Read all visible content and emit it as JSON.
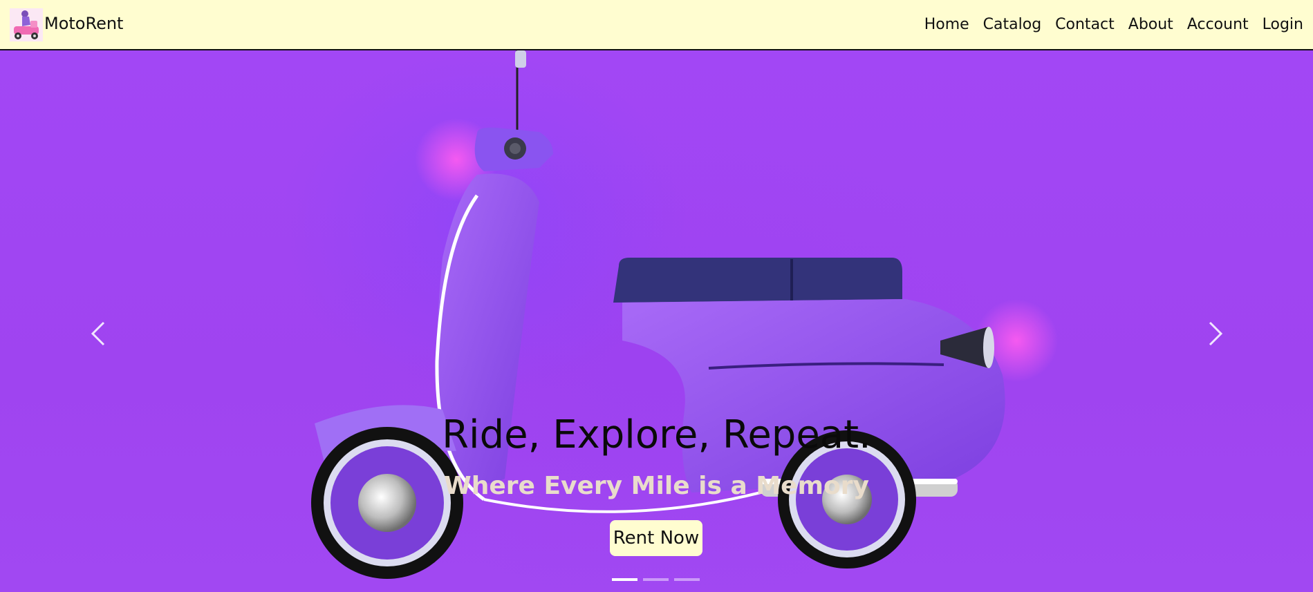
{
  "navbar": {
    "brand": "MotoRent",
    "links": [
      "Home",
      "Catalog",
      "Contact",
      "About",
      "Account",
      "Login"
    ]
  },
  "hero": {
    "title": "Ride, Explore, Repeat.",
    "subtitle": "Where Every Mile is a Memory",
    "cta": "Rent Now",
    "slide_count": 3,
    "active_slide": 1
  },
  "icons": {
    "logo": "scooter-rider-logo",
    "prev": "chevron-left-icon",
    "next": "chevron-right-icon"
  },
  "colors": {
    "navbar_bg": "#fffdd0",
    "hero_bg": "#a044f0",
    "cta_bg": "#fffdd0",
    "subtitle": "#e9dccb"
  }
}
